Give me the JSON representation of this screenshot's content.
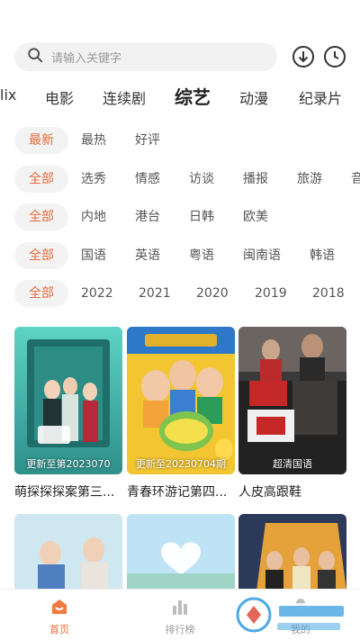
{
  "search": {
    "placeholder": "请输入关键字"
  },
  "header_icons": [
    "download-icon",
    "history-clock-icon"
  ],
  "category_tabs": [
    {
      "label": "lix"
    },
    {
      "label": "电影"
    },
    {
      "label": "连续剧"
    },
    {
      "label": "综艺",
      "active": true
    },
    {
      "label": "动漫"
    },
    {
      "label": "纪录片"
    }
  ],
  "filters": {
    "sort": [
      "最新",
      "最热",
      "好评"
    ],
    "type": [
      "全部",
      "选秀",
      "情感",
      "访谈",
      "播报",
      "旅游",
      "音"
    ],
    "region": [
      "全部",
      "内地",
      "港台",
      "日韩",
      "欧美"
    ],
    "language": [
      "全部",
      "国语",
      "英语",
      "粤语",
      "闽南语",
      "韩语"
    ],
    "year": [
      "全部",
      "2022",
      "2021",
      "2020",
      "2019",
      "2018"
    ]
  },
  "colors": {
    "accent": "#ea6a3a",
    "chip_bg": "#f3f3f3"
  },
  "cards": [
    {
      "title": "萌探探探案第三...",
      "label": "更新至第2023070"
    },
    {
      "title": "青春环游记第四...",
      "label": "更新至20230704期"
    },
    {
      "title": "人皮高跟鞋",
      "label": "超清国语"
    }
  ],
  "bottom_nav": [
    {
      "label": "首页",
      "icon": "home-icon",
      "active": true
    },
    {
      "label": "排行榜",
      "icon": "ranking-icon"
    },
    {
      "label": "我的",
      "icon": "user-icon"
    }
  ]
}
